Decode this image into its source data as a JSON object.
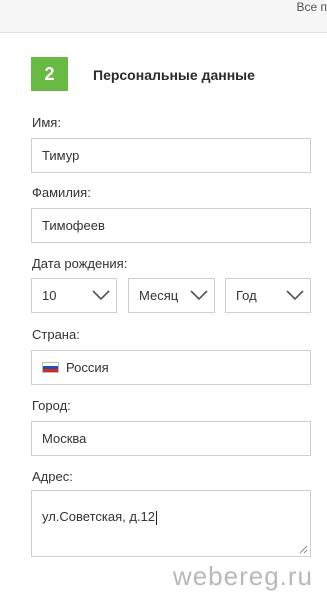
{
  "topbar": {
    "right_link": "Все п"
  },
  "section": {
    "step": "2",
    "title": "Персональные данные"
  },
  "fields": {
    "first_name": {
      "label": "Имя:",
      "value": "Тимур"
    },
    "last_name": {
      "label": "Фамилия:",
      "value": "Тимофеев"
    },
    "birth_date": {
      "label": "Дата рождения:",
      "day": "10",
      "month": "Месяц",
      "year": "Год"
    },
    "country": {
      "label": "Страна:",
      "value": "Россия",
      "flag_colors": [
        "#ffffff",
        "#1f4fbf",
        "#d52b1e"
      ]
    },
    "city": {
      "label": "Город:",
      "value": "Москва"
    },
    "address": {
      "label": "Адрес:",
      "value": "ул.Советская, д.12"
    }
  },
  "colors": {
    "accent": "#68ba45",
    "border": "#cfcfcf"
  },
  "watermark": "webereg.ru"
}
